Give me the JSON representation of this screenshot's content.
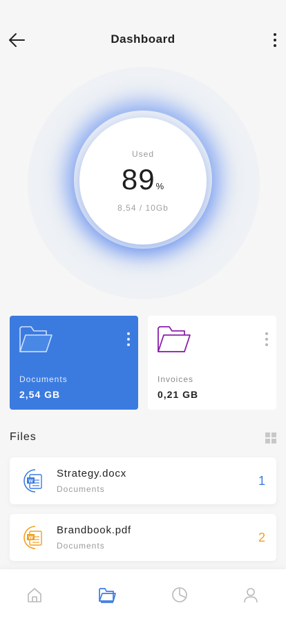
{
  "header": {
    "title": "Dashboard",
    "back_icon": "arrow-left-icon",
    "menu_icon": "more-vertical-icon"
  },
  "storage": {
    "label": "Used",
    "percent": "89",
    "percent_sign": "%",
    "detail": "8,54 / 10Gb",
    "fraction_used": 0.89
  },
  "folders": [
    {
      "name": "Documents",
      "size": "2,54 GB",
      "icon": "folder-icon",
      "color": "#3b7be0",
      "selected": true
    },
    {
      "name": "Invoices",
      "size": "0,21 GB",
      "icon": "folder-icon",
      "color": "#8b1fa9",
      "selected": false
    }
  ],
  "files": {
    "title": "Files",
    "view_icon": "grid-view-icon",
    "items": [
      {
        "name": "Strategy.docx",
        "folder": "Documents",
        "count": "1",
        "icon": "word-doc-icon",
        "accent": "#3b7be0"
      },
      {
        "name": "Brandbook.pdf",
        "folder": "Documents",
        "count": "2",
        "icon": "word-doc-icon",
        "accent": "#f0a01e"
      }
    ]
  },
  "nav": {
    "items": [
      {
        "icon": "home-icon",
        "active": false
      },
      {
        "icon": "folder-icon",
        "active": true
      },
      {
        "icon": "pie-chart-icon",
        "active": false
      },
      {
        "icon": "user-icon",
        "active": false
      }
    ],
    "active_color": "#3b7be0",
    "inactive_color": "#b8b8b8"
  }
}
